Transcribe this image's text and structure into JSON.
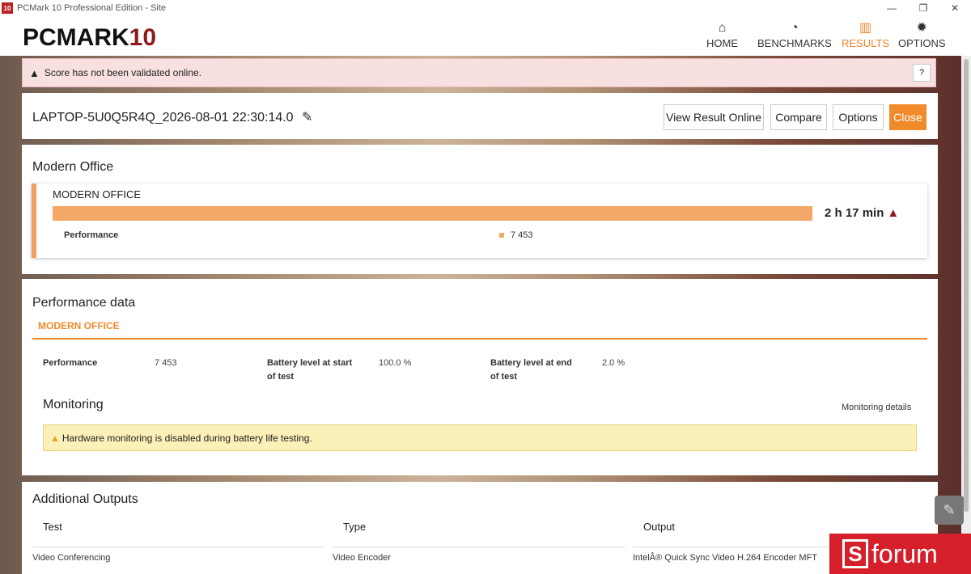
{
  "window": {
    "app_icon": "10",
    "title": "PCMark 10 Professional Edition - Site",
    "controls": {
      "minimize": "—",
      "maximize": "❐",
      "close": "✕"
    }
  },
  "header": {
    "logo_main": "PCMARK",
    "logo_num": "10",
    "nav": [
      {
        "label": "HOME",
        "icon": "home-icon",
        "glyph": "⌂",
        "active": false
      },
      {
        "label": "BENCHMARKS",
        "icon": "speedometer-icon",
        "glyph": "◔",
        "active": false
      },
      {
        "label": "RESULTS",
        "icon": "bar-chart-icon",
        "glyph": "▥",
        "active": true
      },
      {
        "label": "OPTIONS",
        "icon": "gear-icon",
        "glyph": "✹",
        "active": false
      }
    ],
    "accent_color": "#f0822b"
  },
  "alert": {
    "text": "Score has not been validated online.",
    "help": "?"
  },
  "result": {
    "name": "LAPTOP-5U0Q5R4Q_2026-08-01 22:30:14.0",
    "edit_glyph": "✎",
    "buttons": {
      "view_online": "View Result Online",
      "compare": "Compare",
      "options": "Options",
      "close": "Close"
    }
  },
  "modern_office": {
    "section_title": "Modern Office",
    "box_title": "MODERN OFFICE",
    "score": "2 h 17 min",
    "warn_glyph": "▲",
    "sub_label": "Performance",
    "sub_value": "7 453",
    "bar_fill": 1.0
  },
  "performance_data": {
    "section_title": "Performance data",
    "tab": "MODERN OFFICE",
    "items": [
      {
        "label": "Performance",
        "value": "7 453"
      },
      {
        "label": "Battery level at start of test",
        "value": "100.0 %"
      },
      {
        "label": "Battery level at end of test",
        "value": "2.0 %"
      }
    ],
    "monitoring_title": "Monitoring",
    "monitoring_link": "Monitoring details",
    "monitoring_warning": "Hardware monitoring is disabled during battery life testing."
  },
  "additional_outputs": {
    "section_title": "Additional Outputs",
    "columns": [
      "Test",
      "Type",
      "Output"
    ],
    "rows": [
      [
        "Video Conferencing",
        "Video Encoder",
        "IntelÂ® Quick Sync Video H.264 Encoder MFT"
      ]
    ]
  },
  "watermark": {
    "letter": "S",
    "text": "forum"
  }
}
